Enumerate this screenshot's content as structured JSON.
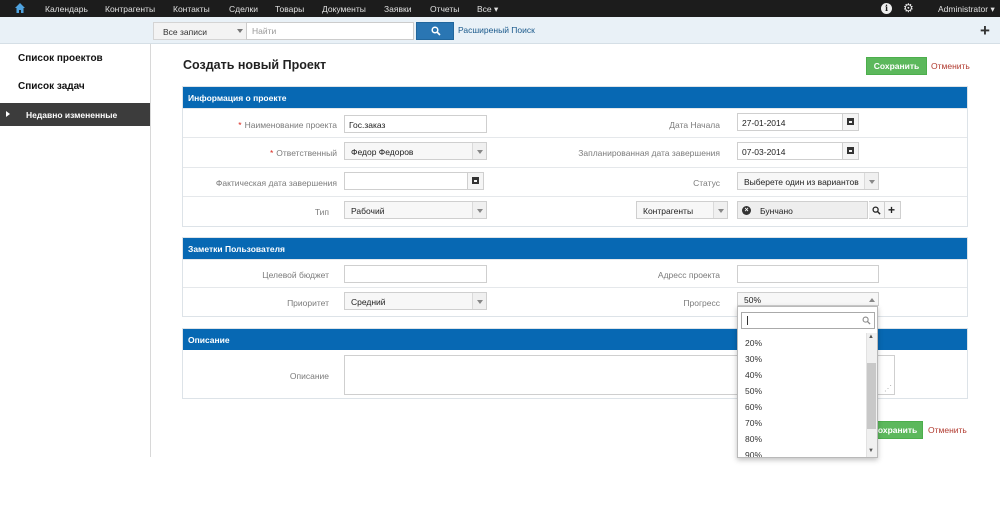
{
  "top_nav": {
    "items": [
      "Календарь",
      "Контрагенты",
      "Контакты",
      "Сделки",
      "Товары",
      "Документы",
      "Заявки",
      "Отчеты",
      "Все"
    ],
    "user": "Administrator"
  },
  "search": {
    "module": "Все записи",
    "placeholder": "Найти",
    "advanced_link": "Расширеный Поиск"
  },
  "sidebar": {
    "links": [
      "Список проектов",
      "Список задач"
    ],
    "active": "Недавно измененные"
  },
  "page": {
    "title": "Создать новый Проект",
    "save": "Сохранить",
    "cancel": "Отменить"
  },
  "sections": {
    "info": {
      "title": "Информация о проекте",
      "name_label": "Наименование проекта",
      "name_value": "Гос.заказ",
      "start_label": "Дата Начала",
      "start_value": "27-01-2014",
      "responsible_label": "Ответственный",
      "responsible_value": "Федор Федоров",
      "planned_end_label": "Запланированная дата завершения",
      "planned_end_value": "07-03-2014",
      "actual_end_label": "Фактическая дата завершения",
      "actual_end_value": "",
      "status_label": "Статус",
      "status_value": "Выберете один из вариантов",
      "type_label": "Тип",
      "type_value": "Рабочий",
      "related_module": "Контрагенты",
      "related_value": "Бунчано"
    },
    "notes": {
      "title": "Заметки Пользователя",
      "budget_label": "Целевой бюджет",
      "budget_value": "",
      "address_label": "Адресс проекта",
      "address_value": "",
      "priority_label": "Приоритет",
      "priority_value": "Средний",
      "progress_label": "Прогресс",
      "progress_value": "50%"
    },
    "description": {
      "title": "Описание",
      "label": "Описание"
    }
  },
  "progress_dropdown": {
    "options": [
      "20%",
      "30%",
      "40%",
      "50%",
      "60%",
      "70%",
      "80%",
      "90%"
    ]
  },
  "colors": {
    "section_header": "#0768b3",
    "save_button": "#5cb85c",
    "cancel_link": "#b13a2f",
    "top_nav": "#1c1c1c"
  }
}
